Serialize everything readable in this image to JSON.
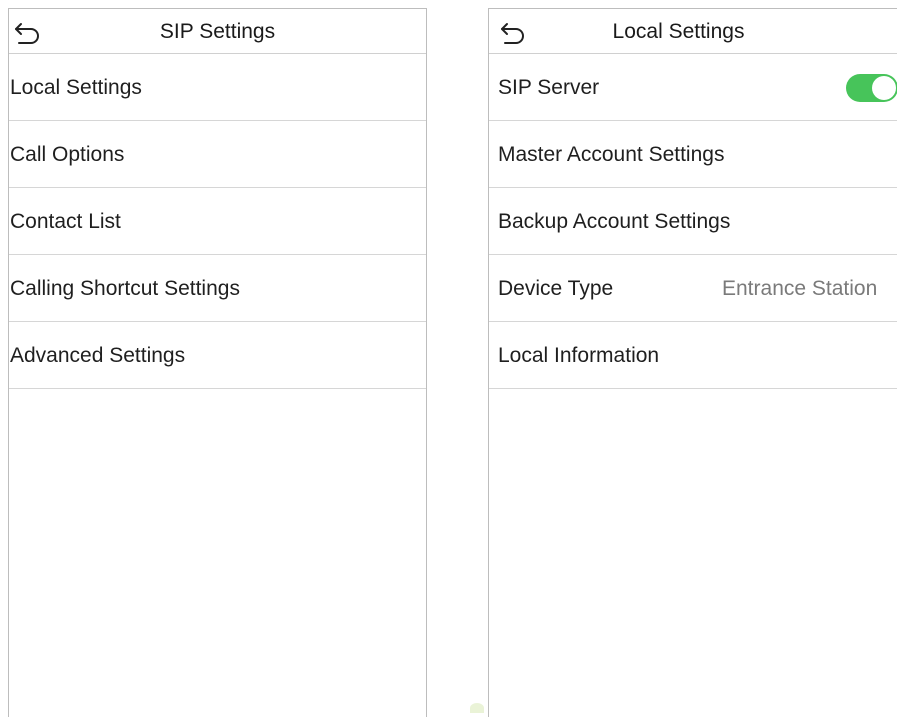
{
  "left_screen": {
    "title": "SIP Settings",
    "back_icon": "back-arrow-icon",
    "menu": [
      {
        "label": "Local Settings"
      },
      {
        "label": "Call Options"
      },
      {
        "label": "Contact List"
      },
      {
        "label": "Calling Shortcut Settings"
      },
      {
        "label": "Advanced Settings"
      }
    ]
  },
  "right_screen": {
    "title": "Local Settings",
    "back_icon": "back-arrow-icon",
    "items": [
      {
        "label": "SIP Server",
        "toggle_on": true
      },
      {
        "label": "Master Account Settings"
      },
      {
        "label": "Backup Account Settings"
      },
      {
        "label": "Device Type",
        "value": "Entrance Station"
      },
      {
        "label": "Local Information"
      }
    ]
  },
  "colors": {
    "toggle_on": "#47c45a",
    "divider": "#d6d6d6",
    "value_text": "#7a7a7a"
  }
}
